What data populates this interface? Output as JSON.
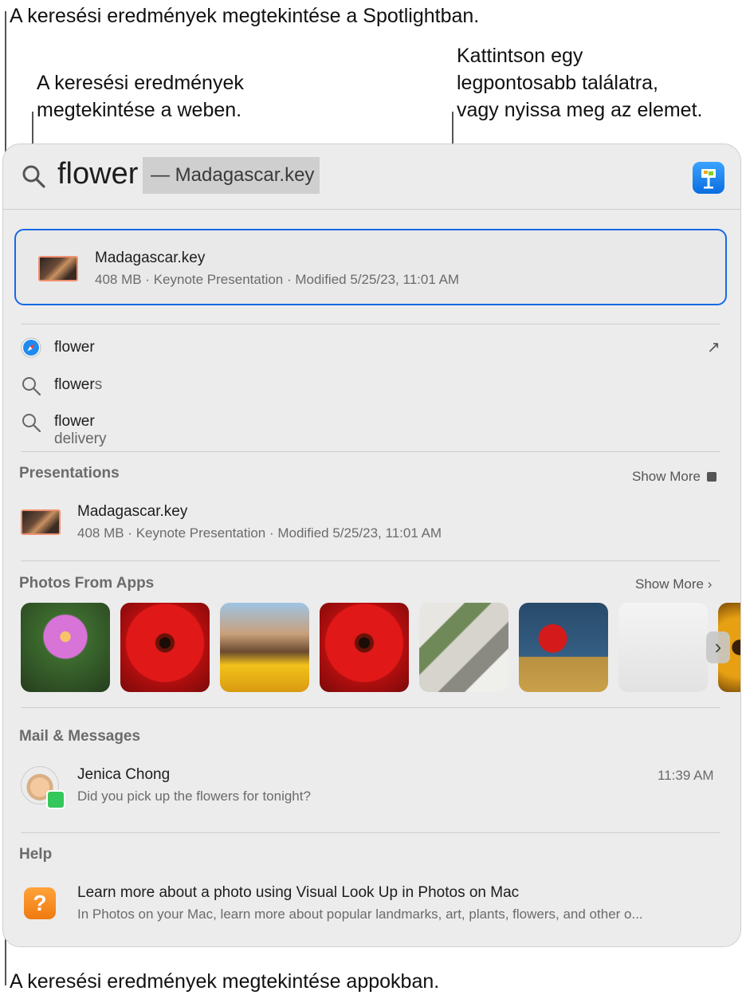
{
  "callouts": {
    "spotlight": "A keresési eredmények megtekintése a Spotlightban.",
    "web_line1": "A keresési eredmények",
    "web_line2": "megtekintése a weben.",
    "top_line1": "Kattintson egy",
    "top_line2": "legpontosabb találatra,",
    "top_line3": "vagy nyissa meg az elemet.",
    "apps": "A keresési eredmények megtekintése appokban."
  },
  "search": {
    "query": "flower",
    "suggestion": "— Madagascar.key",
    "app_icon": "keynote-icon"
  },
  "top_hit": {
    "title": "Madagascar.key",
    "detail": "408 MB · Keynote Presentation · Modified 5/25/23, 11:01 AM"
  },
  "suggestions": [
    {
      "typed": "flower",
      "rest": "",
      "icon": "safari-icon",
      "action": "↗"
    },
    {
      "typed": "flower",
      "rest": "s",
      "icon": "search-icon"
    },
    {
      "typed": "flower",
      "rest": " delivery",
      "icon": "search-icon"
    }
  ],
  "presentations": {
    "header": "Presentations",
    "show_more": "Show More",
    "item_title": "Madagascar.key",
    "item_detail": "408 MB · Keynote Presentation · Modified 5/25/23, 11:01 AM"
  },
  "photos": {
    "header": "Photos From Apps",
    "show_more": "Show More ›",
    "items": [
      "pink-cosmos-flower",
      "red-gerbera-flower",
      "friends-with-sunflowers",
      "red-gerbera-flower",
      "building-collage",
      "person-with-red-flower",
      "document-screenshot",
      "sunflower"
    ]
  },
  "mail": {
    "header": "Mail & Messages",
    "sender": "Jenica Chong",
    "time": "11:39 AM",
    "preview": "Did you pick up the flowers for tonight?"
  },
  "help": {
    "header": "Help",
    "title": "Learn more about a photo using Visual Look Up in Photos on Mac",
    "detail": "In Photos on your Mac, learn more about popular landmarks, art, plants, flowers, and other o..."
  },
  "colors": {
    "accent": "#1769e6",
    "panel": "#ececec"
  }
}
